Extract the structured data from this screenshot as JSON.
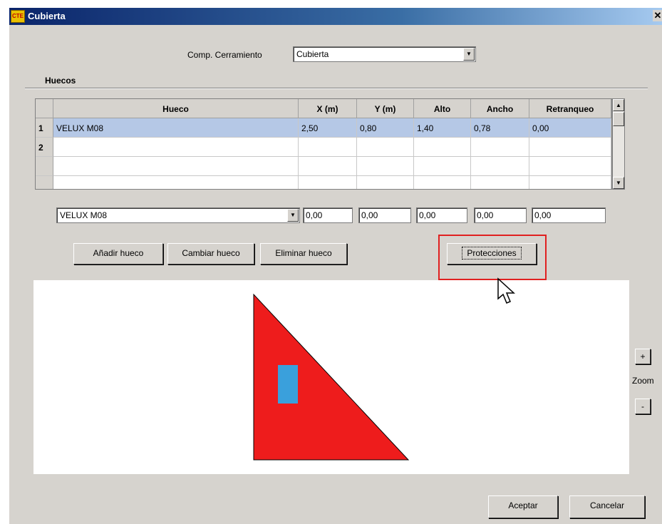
{
  "window": {
    "title": "Cubierta",
    "app_icon_label": "CTE",
    "close_glyph": "✕"
  },
  "comp": {
    "label": "Comp. Cerramiento",
    "value": "Cubierta"
  },
  "section": {
    "title": "Huecos"
  },
  "table": {
    "columns": [
      "Hueco",
      "X (m)",
      "Y (m)",
      "Alto",
      "Ancho",
      "Retranqueo"
    ],
    "rows": [
      {
        "num": "1",
        "hueco": "VELUX M08",
        "x": "2,50",
        "y": "0,80",
        "alto": "1,40",
        "ancho": "0,78",
        "retranqueo": "0,00"
      },
      {
        "num": "2",
        "hueco": "",
        "x": "",
        "y": "",
        "alto": "",
        "ancho": "",
        "retranqueo": ""
      },
      {
        "num": "",
        "hueco": "",
        "x": "",
        "y": "",
        "alto": "",
        "ancho": "",
        "retranqueo": ""
      },
      {
        "num": "",
        "hueco": "",
        "x": "",
        "y": "",
        "alto": "",
        "ancho": "",
        "retranqueo": ""
      }
    ]
  },
  "editor": {
    "hueco": "VELUX M08",
    "x": "0,00",
    "y": "0,00",
    "alto": "0,00",
    "ancho": "0,00",
    "retranqueo": "0,00"
  },
  "buttons": {
    "add": "Añadir hueco",
    "change": "Cambiar hueco",
    "delete": "Eliminar hueco",
    "protections": "Protecciones",
    "zoom_in": "+",
    "zoom_out": "-",
    "zoom_label": "Zoom",
    "accept": "Aceptar",
    "cancel": "Cancelar"
  },
  "colors": {
    "roof": "#ee1c1c",
    "window": "#3aa0dc",
    "selection": "#b5c8e6",
    "highlight": "#e02020"
  }
}
